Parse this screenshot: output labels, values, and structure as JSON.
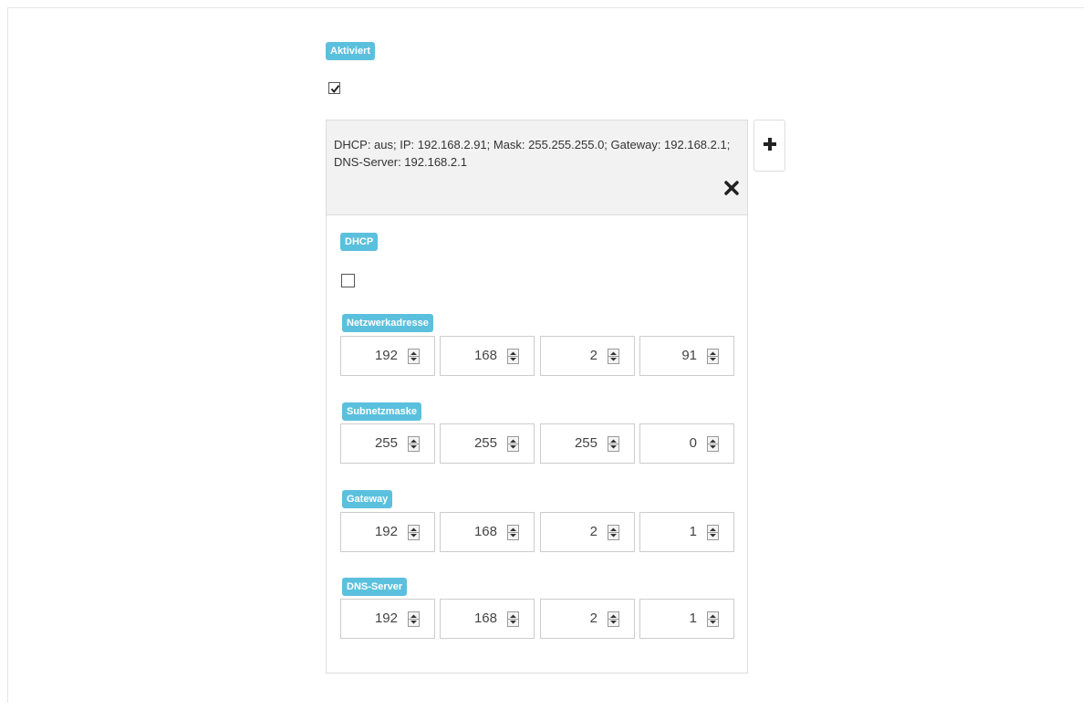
{
  "activated": {
    "label": "Aktiviert",
    "checked": true
  },
  "entry": {
    "summary": "DHCP: aus; IP: 192.168.2.91; Mask: 255.255.255.0; Gateway: 192.168.2.1; DNS-Server: 192.168.2.1",
    "remove_icon": "close-icon",
    "add_icon": "plus-icon"
  },
  "dhcp": {
    "label": "DHCP",
    "checked": false
  },
  "network_address": {
    "label": "Netzwerkadresse",
    "octets": [
      "192",
      "168",
      "2",
      "91"
    ]
  },
  "subnet_mask": {
    "label": "Subnetzmaske",
    "octets": [
      "255",
      "255",
      "255",
      "0"
    ]
  },
  "gateway": {
    "label": "Gateway",
    "octets": [
      "192",
      "168",
      "2",
      "1"
    ]
  },
  "dns_server": {
    "label": "DNS-Server",
    "octets": [
      "192",
      "168",
      "2",
      "1"
    ]
  },
  "colors": {
    "badge": "#5bc0de",
    "header_bg": "#f2f2f2",
    "border": "#dddddd"
  }
}
